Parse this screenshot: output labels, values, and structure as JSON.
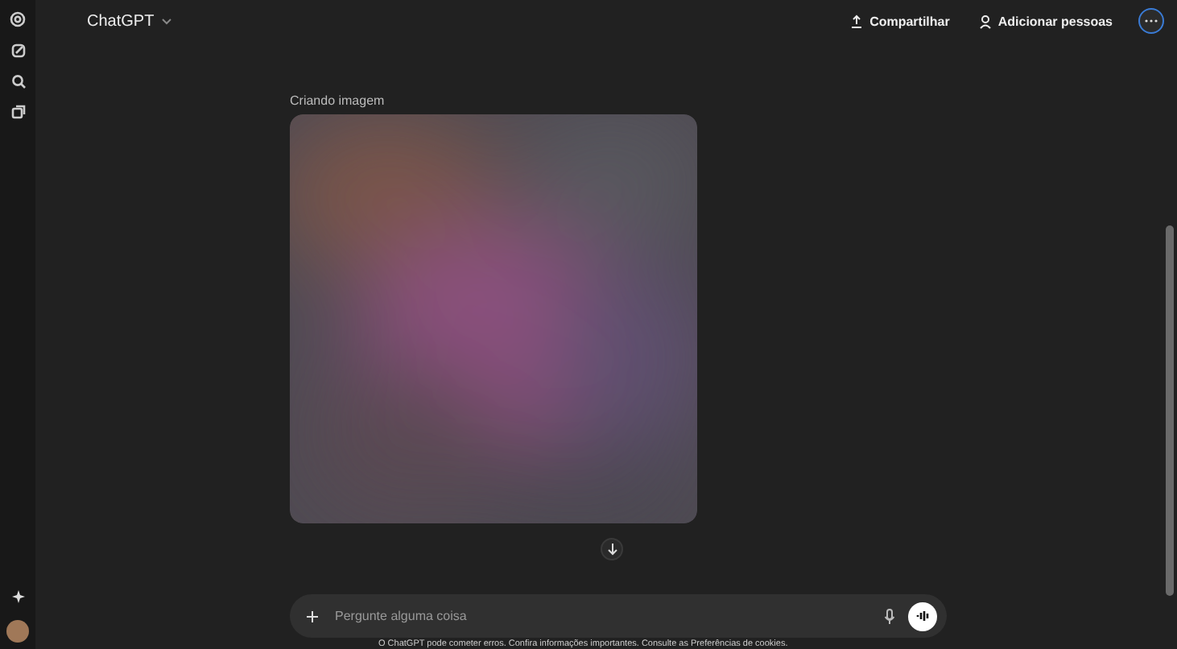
{
  "header": {
    "model": "ChatGPT",
    "share": "Compartilhar",
    "add_people": "Adicionar pessoas"
  },
  "chat": {
    "status": "Criando imagem"
  },
  "composer": {
    "placeholder": "Pergunte alguma coisa"
  },
  "footer": "O ChatGPT pode cometer erros. Confira informações importantes. Consulte as Preferências de cookies."
}
